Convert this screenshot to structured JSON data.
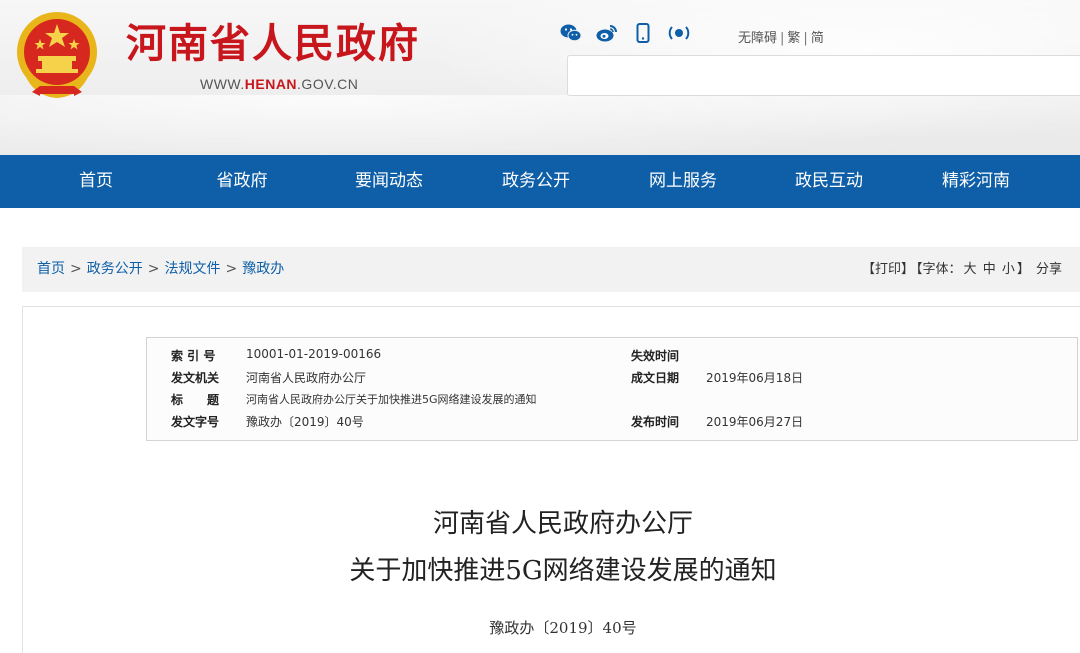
{
  "header": {
    "title": "河南省人民政府",
    "url_prefix": "WWW.",
    "url_highlight": "HENAN",
    "url_suffix": ".GOV.CN",
    "social_icons": [
      "wechat-icon",
      "weibo-icon",
      "mobile-icon",
      "audio-icon"
    ],
    "links": {
      "accessibility": "无障碍",
      "sep": "|",
      "traditional": "繁",
      "simplified": "简"
    },
    "brand_color": "#c8161d"
  },
  "nav": {
    "color": "#0e5fa7",
    "items": [
      "首页",
      "省政府",
      "要闻动态",
      "政务公开",
      "网上服务",
      "政民互动",
      "精彩河南"
    ]
  },
  "breadcrumb": {
    "items": [
      "首页",
      "政务公开",
      "法规文件",
      "豫政办"
    ],
    "separator": ">"
  },
  "tools": {
    "print": "【打印】",
    "font_prefix": "【字体：",
    "font_large": "大",
    "font_medium": "中",
    "font_small": "小",
    "font_suffix": "】",
    "share": "分享"
  },
  "meta": {
    "index_label": "索 引 号",
    "index_value": "10001-01-2019-00166",
    "issuer_label": "发文机关",
    "issuer_value": "河南省人民政府办公厅",
    "title_label": "标　　题",
    "title_value": "河南省人民政府办公厅关于加快推进5G网络建设发展的通知",
    "docno_label": "发文字号",
    "docno_value": "豫政办〔2019〕40号",
    "expire_label": "失效时间",
    "expire_value": "",
    "created_label": "成文日期",
    "created_value": "2019年06月18日",
    "publish_label": "发布时间",
    "publish_value": "2019年06月27日"
  },
  "document": {
    "title_line1": "河南省人民政府办公厅",
    "title_line2": "关于加快推进5G网络建设发展的通知",
    "number": "豫政办〔2019〕40号"
  }
}
